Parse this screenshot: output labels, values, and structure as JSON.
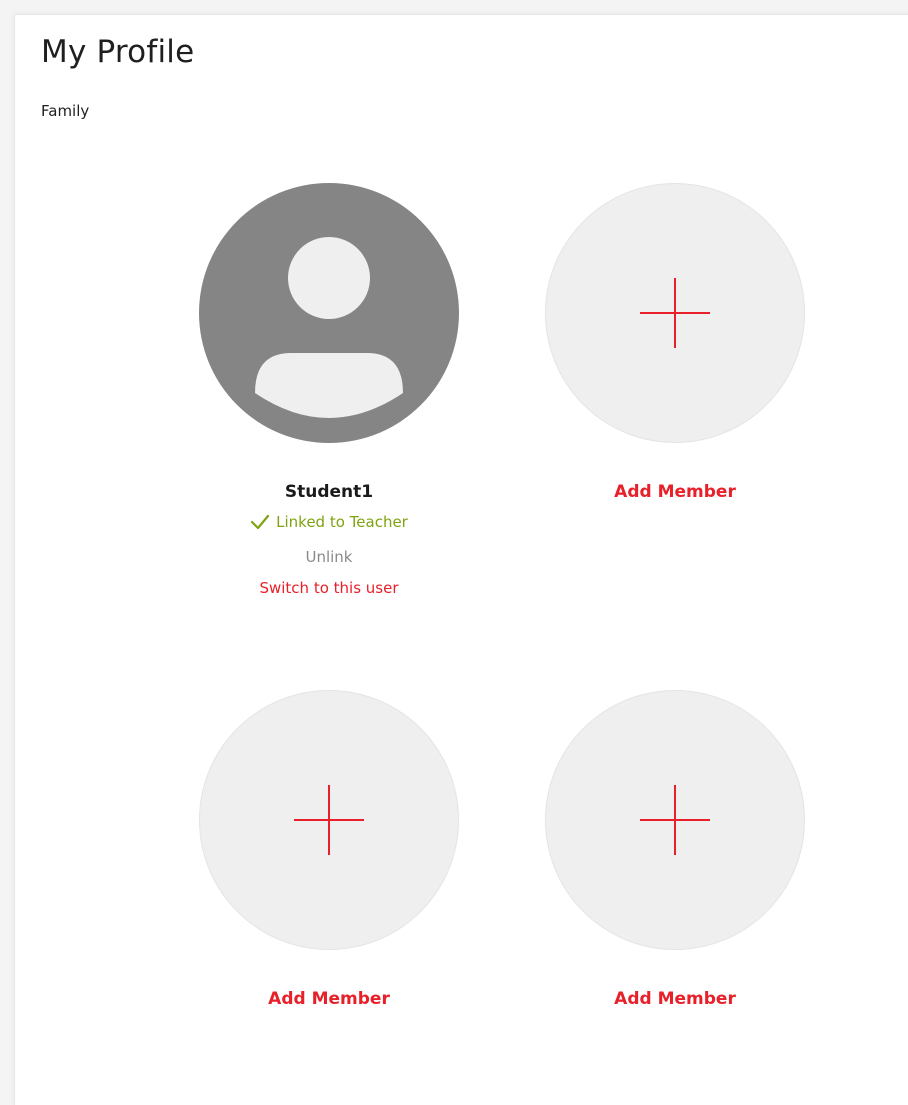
{
  "page": {
    "title": "My Profile",
    "section": "Family"
  },
  "members": [
    {
      "name": "Student1",
      "status": "Linked to Teacher",
      "unlink_label": "Unlink",
      "switch_label": "Switch to this user"
    }
  ],
  "add_member_label": "Add Member",
  "icons": {
    "avatar": "user-avatar-icon",
    "add": "plus-icon",
    "linked": "check-icon"
  },
  "colors": {
    "accent": "#e8202a",
    "linked": "#7fa312",
    "muted": "#8a8a8a",
    "avatar_bg": "#858585",
    "add_bg": "#efefef"
  }
}
